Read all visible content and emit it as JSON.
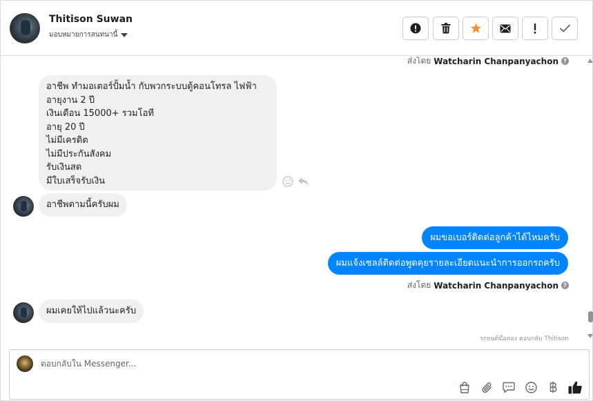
{
  "header": {
    "contact_name": "Thitison Suwan",
    "status": "มอบหมายการสนทนานี้",
    "actions": [
      {
        "name": "report-button",
        "icon": "alert-circle-icon"
      },
      {
        "name": "delete-button",
        "icon": "trash-icon"
      },
      {
        "name": "star-button",
        "icon": "star-icon",
        "color": "#f7923a"
      },
      {
        "name": "mark-unread-button",
        "icon": "envelope-icon"
      },
      {
        "name": "flag-button",
        "icon": "exclamation-icon"
      },
      {
        "name": "mark-done-button",
        "icon": "check-icon"
      }
    ]
  },
  "thread": {
    "sent_by_top": {
      "prefix": "ส่งโดย",
      "name": "Watcharin Chanpanyachon",
      "help": "?"
    },
    "incoming_1": {
      "lines": [
        "อาชีพ ทำมอเตอร์ปั้มน้ำ กับพวกระบบตู้คอนโทรล ไฟฟ้า",
        "อายุงาน 2 ปี",
        "เงินเดือน 15000+ รวมโอที",
        "อายุ 20 ปี",
        "ไม่มีเครดิต",
        "ไม่มีประกันสังคม",
        "รับเงินสด",
        "มีใบเสร็จรับเงิน"
      ]
    },
    "incoming_2": "อาชีพตามนี้ครับผม",
    "outgoing_1": "ผมขอเบอร์ติดต่อลูกค้าได้ไหมครับ",
    "outgoing_2": "ผมแจ้งเซลล์ติดต่อพูดคุยรายละเอียดแนะนำการออกรถครับ",
    "sent_by_bottom": {
      "prefix": "ส่งโดย",
      "name": "Watcharin Chanpanyachon",
      "help": "?"
    },
    "incoming_3": "ผมเคยให้ไปแล้วนะครับ",
    "replied_note": "รถยนต์มือสอง ตอบกลับ Thitison"
  },
  "composer": {
    "placeholder": "ตอบกลับใน Messenger...",
    "tools": [
      "bag-icon",
      "paperclip-icon",
      "chat-bubble-icon",
      "smiley-icon",
      "baht-icon",
      "thumbs-up-icon"
    ]
  },
  "colors": {
    "outgoing_bubble": "#0084ff",
    "incoming_bubble": "#f0f0f0",
    "star": "#f7923a"
  }
}
